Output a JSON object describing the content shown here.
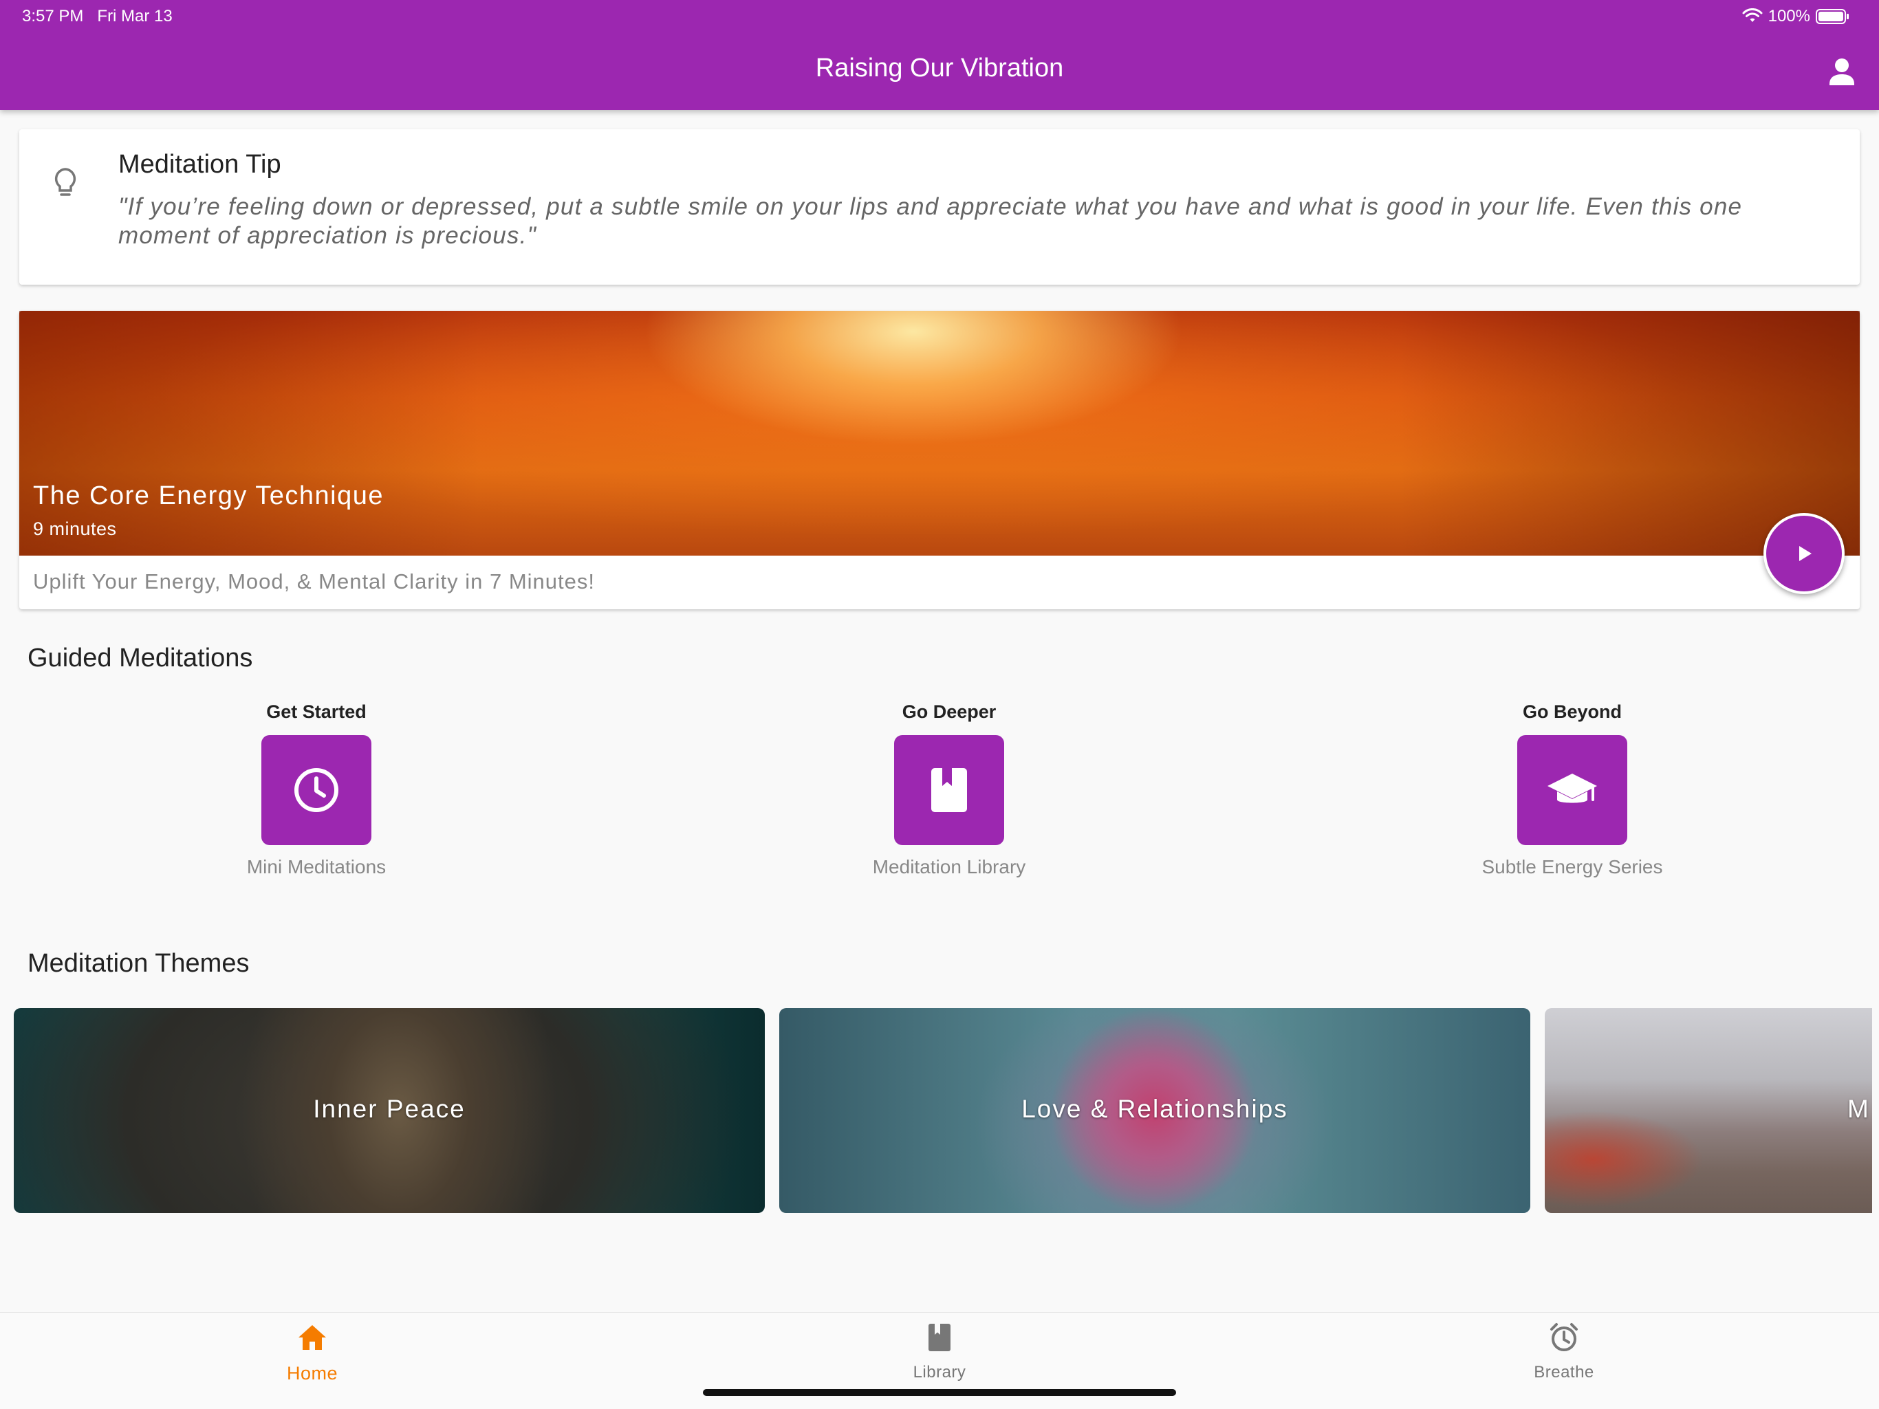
{
  "status_bar": {
    "time": "3:57 PM",
    "date": "Fri Mar 13",
    "battery": "100%"
  },
  "header": {
    "title": "Raising Our Vibration",
    "profile_icon": "person-icon"
  },
  "colors": {
    "primary": "#9c27b0",
    "accent_orange": "#f57c00",
    "background": "#f9f9f9"
  },
  "tip": {
    "icon": "lightbulb-icon",
    "title": "Meditation Tip",
    "text": "\"If you’re feeling down or depressed, put a subtle smile on your lips and appreciate what you have and what is good in your life. Even this one moment of appreciation is precious.\""
  },
  "featured": {
    "title": "The Core Energy Technique",
    "duration": "9 minutes",
    "description": "Uplift Your Energy, Mood, & Mental Clarity in 7 Minutes!",
    "play_icon": "play-icon"
  },
  "guided": {
    "title": "Guided Meditations",
    "items": [
      {
        "label": "Get Started",
        "caption": "Mini Meditations",
        "icon": "clock-icon"
      },
      {
        "label": "Go Deeper",
        "caption": "Meditation Library",
        "icon": "book-icon"
      },
      {
        "label": "Go Beyond",
        "caption": "Subtle Energy Series",
        "icon": "graduation-cap-icon"
      }
    ]
  },
  "themes": {
    "title": "Meditation Themes",
    "items": [
      {
        "label": "Inner Peace"
      },
      {
        "label": "Love & Relationships"
      },
      {
        "label": "M"
      }
    ]
  },
  "bottom_nav": {
    "items": [
      {
        "label": "Home",
        "icon": "home-icon",
        "active": true
      },
      {
        "label": "Library",
        "icon": "book-icon",
        "active": false
      },
      {
        "label": "Breathe",
        "icon": "alarm-clock-icon",
        "active": false
      }
    ]
  }
}
